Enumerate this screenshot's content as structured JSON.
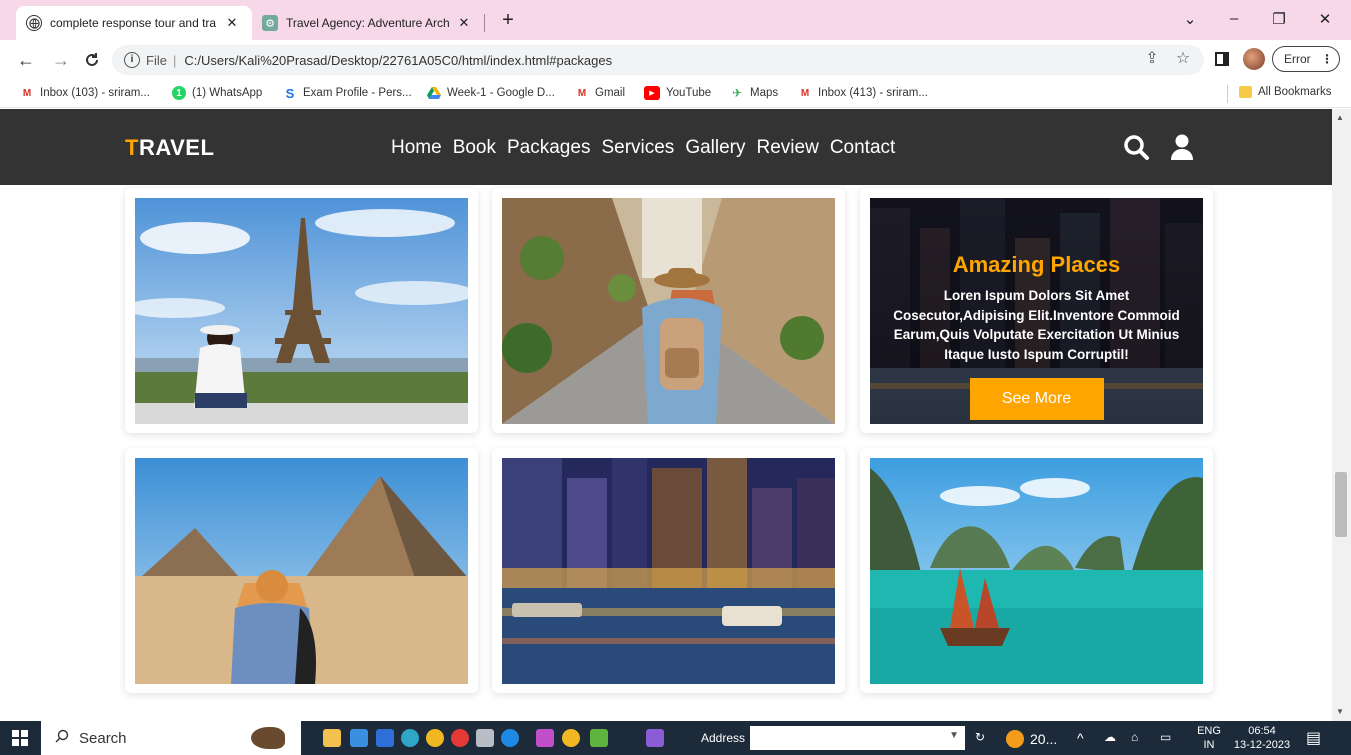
{
  "browser": {
    "tabs": [
      {
        "title": "complete response tour and tra",
        "active": true
      },
      {
        "title": "Travel Agency: Adventure Archite",
        "active": false
      }
    ],
    "new_tab": "+",
    "window_controls": {
      "minimize": "–",
      "maximize": "❐",
      "close": "✕"
    },
    "address": {
      "scheme": "File",
      "url": "C:/Users/Kali%20Prasad/Desktop/22761A05C0/html/index.html#packages"
    },
    "error_label": "Error",
    "bookmarks": [
      {
        "label": "Inbox (103) - sriram...",
        "icon": "gmail-icon",
        "color": "#d93025"
      },
      {
        "label": "(1) WhatsApp",
        "icon": "whatsapp-icon",
        "color": "#25d366"
      },
      {
        "label": "Exam Profile - Pers...",
        "icon": "s-logo-icon",
        "color": "#1a73e8"
      },
      {
        "label": "Week-1 - Google D...",
        "icon": "google-drive-icon",
        "color": "#f4b400"
      },
      {
        "label": "Gmail",
        "icon": "gmail-icon",
        "color": "#d93025"
      },
      {
        "label": "YouTube",
        "icon": "youtube-icon",
        "color": "#ff0000"
      },
      {
        "label": "Maps",
        "icon": "maps-icon",
        "color": "#34a853"
      },
      {
        "label": "Inbox (413) - sriram...",
        "icon": "gmail-icon",
        "color": "#d93025"
      }
    ],
    "all_bookmarks": "All Bookmarks"
  },
  "site": {
    "logo_first": "T",
    "logo_rest": "RAVEL",
    "accent_color": "#ffa500",
    "header_bg": "#333333",
    "nav": [
      "Home",
      "Book",
      "Packages",
      "Services",
      "Gallery",
      "Review",
      "Contact"
    ],
    "packages": [
      {
        "scene": "eiffel-tower"
      },
      {
        "scene": "paris-street"
      },
      {
        "scene": "city-night-overlay",
        "overlay": {
          "title": "Amazing Places",
          "text": "Loren Ispum Dolors Sit Amet Cosecutor,Adipising Elit.Inventore Commoid Earum,Quis Volputate Exercitation Ut Minius Itaque Iusto Ispum Corruptil!",
          "button": "See More"
        }
      },
      {
        "scene": "pyramids"
      },
      {
        "scene": "night-city-river"
      },
      {
        "scene": "halong-bay"
      }
    ]
  },
  "taskbar": {
    "search": "Search",
    "address_label": "Address",
    "weather": "20...",
    "lang_top": "ENG",
    "lang_bottom": "IN",
    "time": "06:54",
    "date": "13-12-2023"
  }
}
